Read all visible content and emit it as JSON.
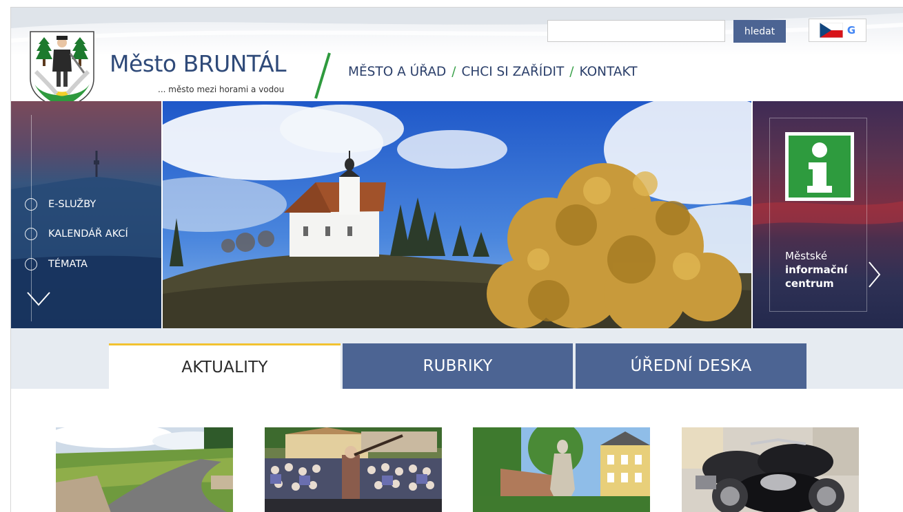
{
  "header": {
    "title": "Město BRUNTÁL",
    "tagline": "... město mezi horami a vodou",
    "brand_color": "#2f4a79",
    "accent_color": "#3aa14a"
  },
  "search": {
    "value": "",
    "placeholder": "",
    "button_label": "hledat"
  },
  "language": {
    "flag": "cz-flag-icon",
    "translate_letter": "G"
  },
  "topnav": {
    "items": [
      {
        "label": "MĚSTO A ÚŘAD"
      },
      {
        "label": "CHCI SI ZAŘÍDIT"
      },
      {
        "label": "KONTAKT"
      }
    ],
    "separator": "/"
  },
  "quick_links": {
    "items": [
      {
        "label": "E-SLUŽBY"
      },
      {
        "label": "KALENDÁŘ AKCÍ"
      },
      {
        "label": "TÉMATA"
      }
    ]
  },
  "info_centre": {
    "line1": "Městské",
    "line2": "informační",
    "line3": "centrum",
    "icon": "info-icon"
  },
  "tabs": {
    "items": [
      {
        "label": "AKTUALITY",
        "active": true
      },
      {
        "label": "RUBRIKY",
        "active": false
      },
      {
        "label": "ÚŘEDNÍ DESKA",
        "active": false
      }
    ],
    "active_color": "#f2c230",
    "inactive_color": "#4c6493"
  }
}
